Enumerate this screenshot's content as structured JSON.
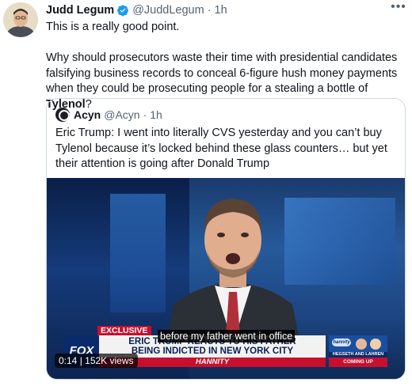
{
  "tweet": {
    "author_name": "Judd Legum",
    "author_handle": "@JuddLegum",
    "separator": "·",
    "time": "1h",
    "more_icon": "more-horizontal-icon",
    "verified_color": "#1d9bf0",
    "text_line1": "This is a really good point.",
    "text_para2_before": "Why should prosecutors waste their time with presidential candidates falsifying business records to conceal 6-figure hush money payments when they could be prosecuting people for a stealing a bottle of ",
    "text_para2_bold": "Tylenol",
    "text_para2_after": "?"
  },
  "quote": {
    "author_name": "Acyn",
    "author_handle": "@Acyn",
    "separator": "·",
    "time": "1h",
    "text": "Eric Trump: I went into literally CVS yesterday and you can’t buy Tylenol because it’s locked behind these glass counters… but yet their attention is going after Donald Trump",
    "video": {
      "exclusive_tag": "EXCLUSIVE",
      "network_logo": "FOX",
      "headline_line1": "ERIC TRUMP REACTS TO HIS FATHER",
      "headline_line2": "BEING INDICTED IN NEW YORK CITY",
      "show_name": "HANNITY",
      "promo_badge": "hannity",
      "promo_top": "HEGSETH AND LAHREN",
      "promo_label": "COMING UP",
      "caption": "before my father went in office",
      "duration": "0:14",
      "views": "152K views",
      "brand_red": "#c8102e",
      "brand_blue": "#0b2a6b"
    }
  }
}
